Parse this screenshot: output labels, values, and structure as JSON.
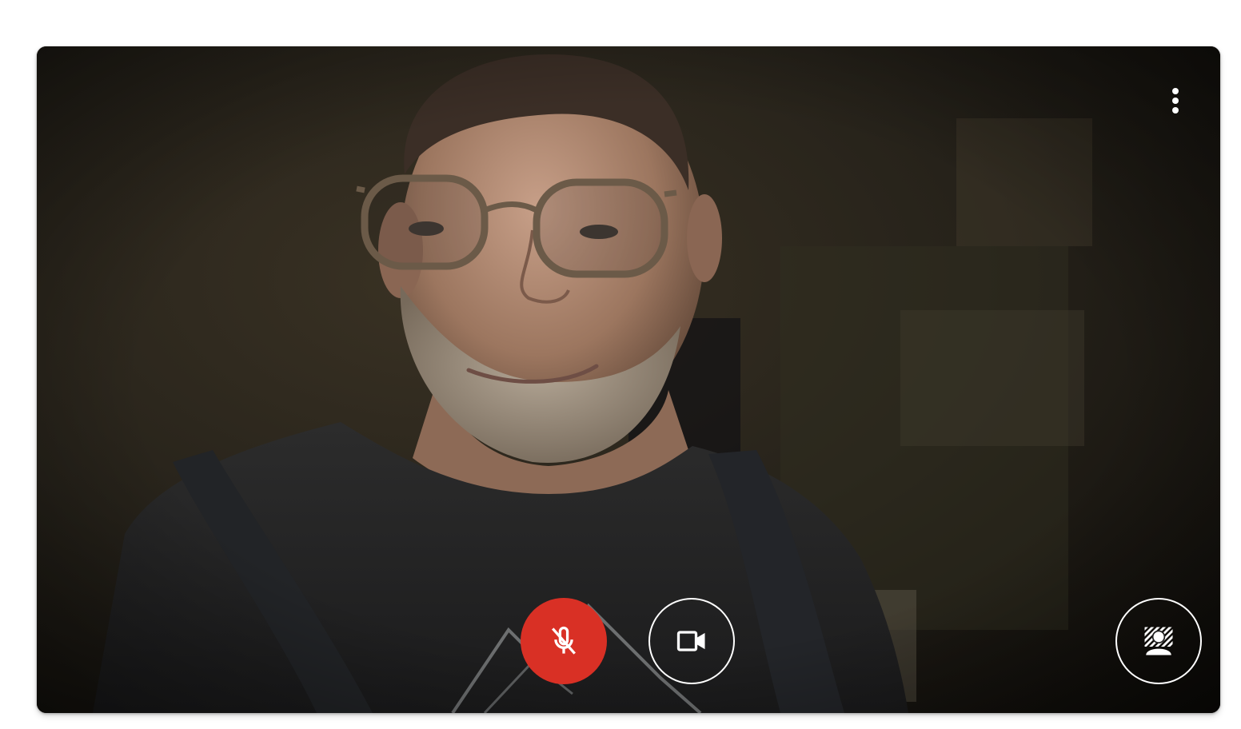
{
  "colors": {
    "mute_active": "#d93025",
    "control_outline": "#ffffff",
    "page_background": "#ffffff"
  },
  "preview": {
    "video_state": "camera-on",
    "overflow_menu_icon": "more-vert-icon"
  },
  "controls": {
    "microphone": {
      "icon": "mic-off-icon",
      "state": "muted"
    },
    "camera": {
      "icon": "videocam-icon",
      "state": "on"
    },
    "visual_effects": {
      "icon": "background-effects-icon"
    }
  }
}
